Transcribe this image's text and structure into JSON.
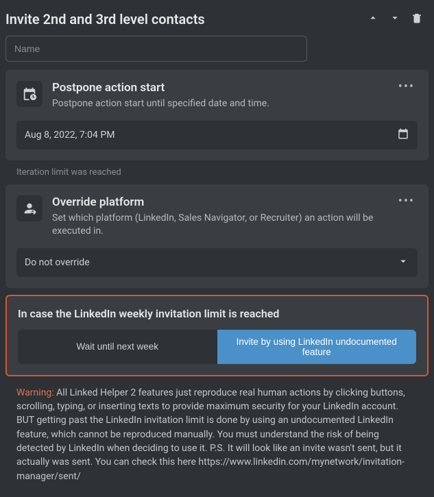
{
  "header": {
    "title": "Invite 2nd and 3rd level contacts"
  },
  "name": {
    "placeholder": "Name",
    "value": ""
  },
  "postpone": {
    "title": "Postpone action start",
    "desc": "Postpone action start until specified date and time.",
    "datetime": "Aug 8, 2022, 7:04 PM"
  },
  "iteration_note": "Iteration limit was reached",
  "override": {
    "title": "Override platform",
    "desc": "Set which platform (LinkedIn, Sales Navigator, or Recruiter) an action will be executed in.",
    "selected": "Do not override"
  },
  "limit_card": {
    "title": "In case the LinkedIn weekly invitation limit is reached",
    "option_wait": "Wait until next week",
    "option_bypass": "Invite by using LinkedIn undocumented feature"
  },
  "warning": {
    "label": "Warning:",
    "text": " All Linked Helper 2 features just reproduce real human actions by clicking buttons, scrolling, typing, or inserting texts to provide maximum security for your LinkedIn account. BUT getting past the LinkedIn invitation limit is done by using an undocumented LinkedIn feature, which cannot be reproduced manually. You must understand the risk of being detected by LinkedIn when deciding to use it. P.S. It will look like an invite wasn't sent, but it actually was sent. You can check this here https://www.linkedin.com/mynetwork/invitation-manager/sent/"
  }
}
